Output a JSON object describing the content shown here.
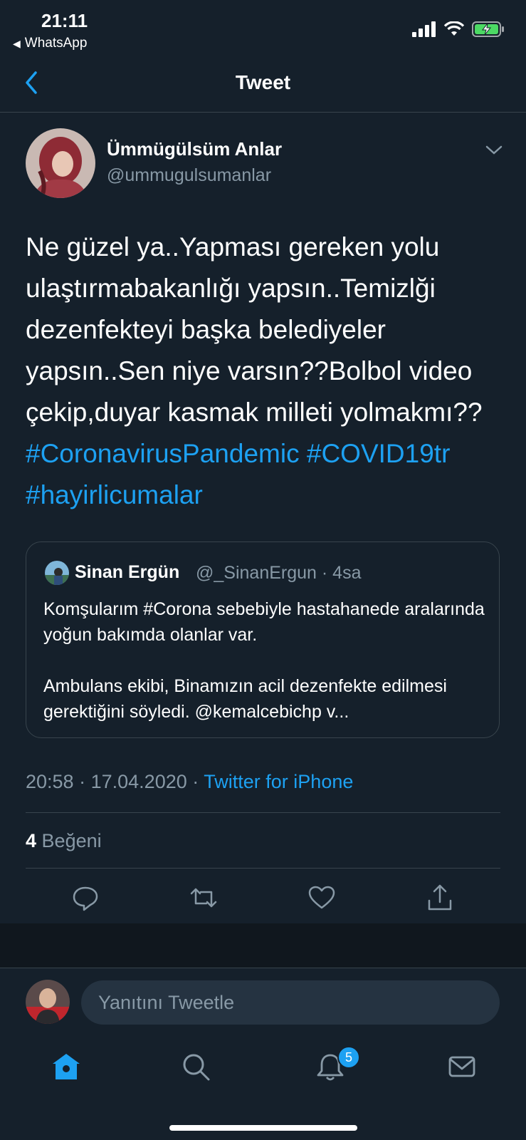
{
  "status_bar": {
    "time": "21:11",
    "back_app": "WhatsApp"
  },
  "header": {
    "title": "Tweet"
  },
  "tweet": {
    "author_name": "Ümmügülsüm Anlar",
    "author_handle": "@ummugulsumanlar",
    "text": "Ne güzel ya..Yapması gereken yolu ulaştırmabakanlığı yapsın..Temizlği dezenfekteyi başka belediyeler yapsın..Sen niye varsın??Bolbol video çekip,duyar kasmak milleti yolmakmı??",
    "hashtags": [
      "#CoronavirusPandemic",
      "#COVID19tr",
      "#hayirlicumalar"
    ]
  },
  "quoted": {
    "name": "Sinan Ergün",
    "handle": "@_SinanErgun",
    "age": "4sa",
    "line1": "Komşularım #Corona sebebiyle hastahanede aralarında yoğun bakımda olanlar var.",
    "line2": "Ambulans ekibi, Binamızın acil dezenfekte edilmesi gerektiğini söyledi. @kemalcebichp v..."
  },
  "meta": {
    "time": "20:58",
    "date": "17.04.2020",
    "source": "Twitter for iPhone",
    "separator": "·"
  },
  "likes": {
    "count": "4",
    "label": "Beğeni"
  },
  "reply": {
    "placeholder": "Yanıtını Tweetle"
  },
  "tabs": {
    "notifications_badge": "5"
  },
  "colors": {
    "background": "#15202b",
    "accent": "#1da1f2",
    "muted": "#8899a6",
    "border": "#38444d"
  }
}
